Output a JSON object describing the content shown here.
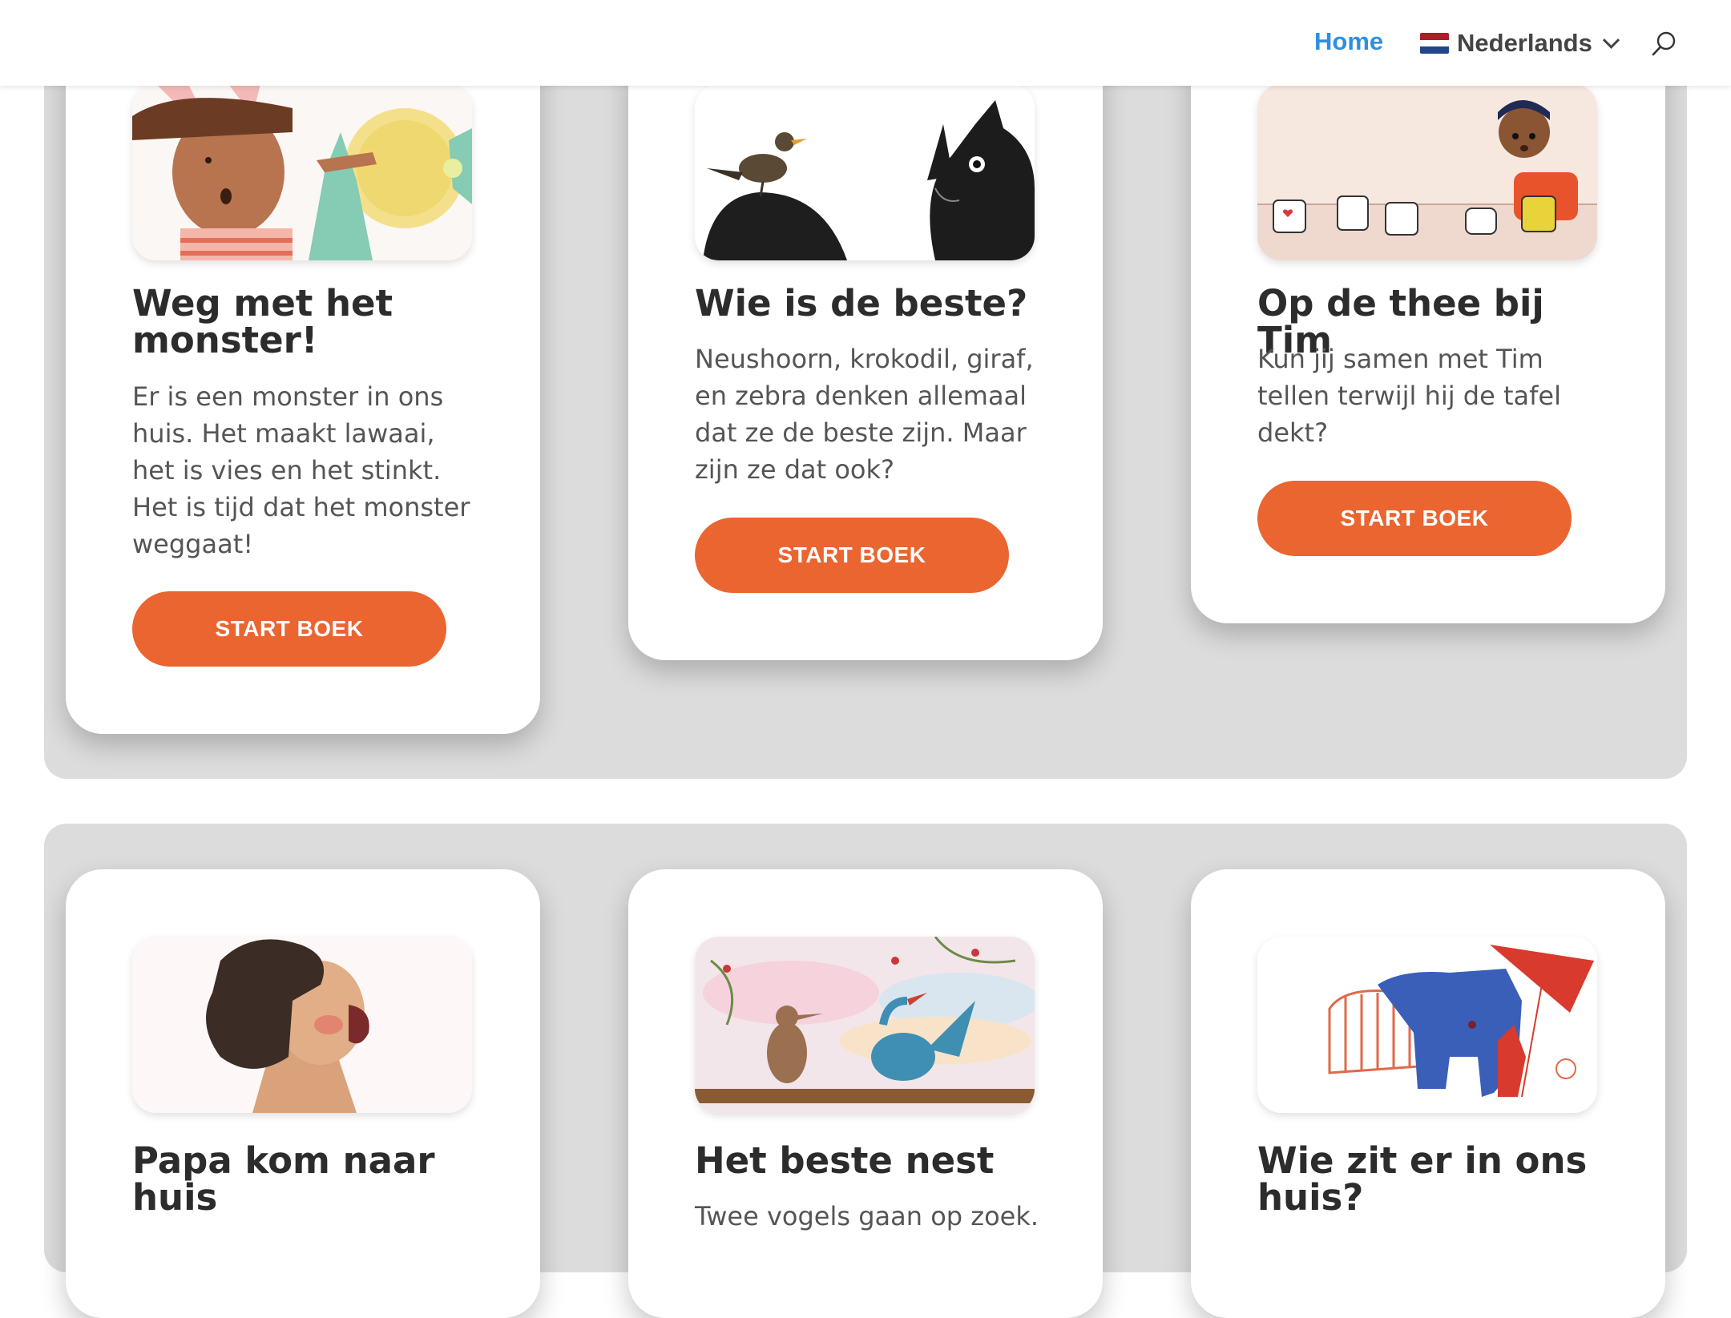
{
  "header": {
    "nav_home": "Home",
    "language": "Nederlands",
    "search_icon": "search-icon",
    "flag_colors": [
      "#ae1c28",
      "#ffffff",
      "#21468b"
    ]
  },
  "colors": {
    "accent": "#ea6530",
    "nav_active": "#2f8ee0",
    "section_bg": "#dcdcdc"
  },
  "books": [
    {
      "title": "Weg met het monster!",
      "description": "Er is een monster in ons huis. Het maakt lawaai, het is vies en het stinkt. Het is tijd dat het monster weggaat!",
      "button": "START BOEK"
    },
    {
      "title": "Wie is de beste?",
      "description": "Neushoorn, krokodil, giraf, en zebra denken allemaal dat ze de beste zijn. Maar zijn ze dat ook?",
      "button": "START BOEK"
    },
    {
      "title": "Op de thee bij Tim",
      "description": "Kun jij samen met Tim tellen terwijl hij de tafel dekt?",
      "button": "START BOEK"
    },
    {
      "title": "Papa kom naar huis",
      "description": ""
    },
    {
      "title": "Het beste nest",
      "description": "Twee vogels gaan op zoek."
    },
    {
      "title": "Wie zit er in ons huis?",
      "description": ""
    }
  ]
}
